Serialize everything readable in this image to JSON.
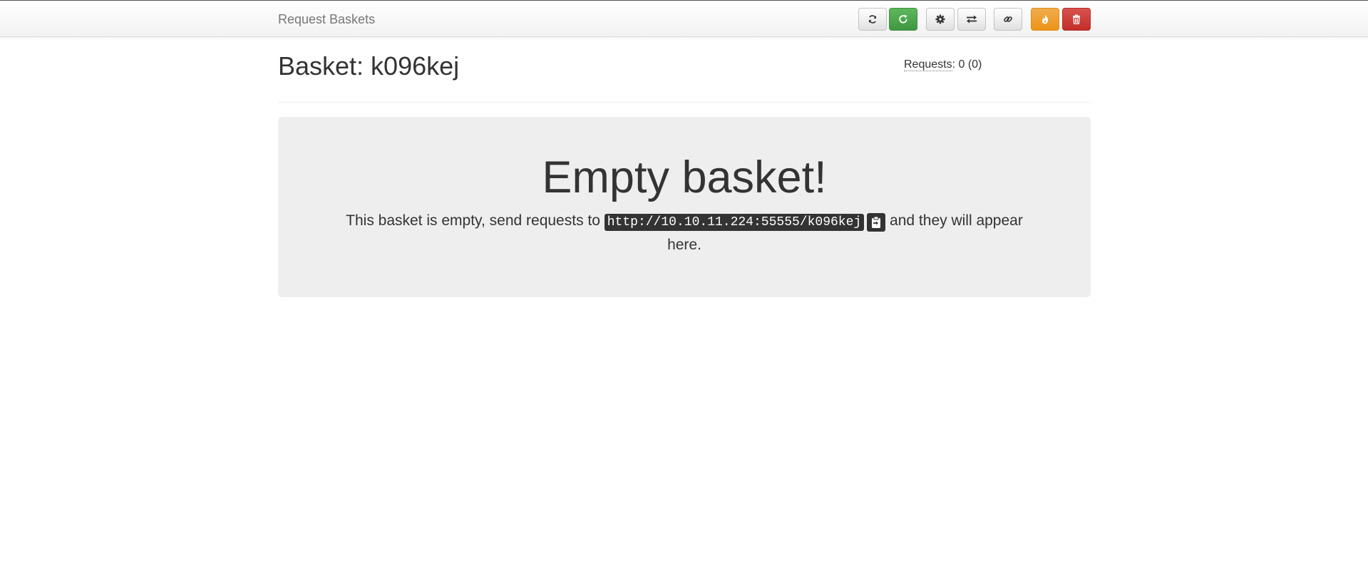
{
  "app": {
    "brand": "Request Baskets"
  },
  "toolbar": {
    "buttons": [
      {
        "name": "refresh",
        "icon": "refresh-icon",
        "style": "default"
      },
      {
        "name": "auto-refresh",
        "icon": "auto-refresh-icon",
        "style": "success"
      },
      {
        "name": "settings",
        "icon": "gear-icon",
        "style": "default"
      },
      {
        "name": "responses",
        "icon": "transfer-icon",
        "style": "default"
      },
      {
        "name": "share",
        "icon": "link-icon",
        "style": "default"
      },
      {
        "name": "clear",
        "icon": "fire-icon",
        "style": "warning"
      },
      {
        "name": "delete",
        "icon": "trash-icon",
        "style": "danger"
      }
    ]
  },
  "header": {
    "title": "Basket: k096kej",
    "requests_label": "Requests",
    "requests_value": ": 0 (0)"
  },
  "empty": {
    "heading": "Empty basket!",
    "text_before": "This basket is empty, send requests to ",
    "url": "http://10.10.11.224:55555/k096kej",
    "text_after": " and they will appear here."
  },
  "colors": {
    "success": "#5cb85c",
    "warning": "#f0ad4e",
    "danger": "#d9534f",
    "jumbotron_bg": "#eeeeee",
    "code_bg": "#333333"
  }
}
